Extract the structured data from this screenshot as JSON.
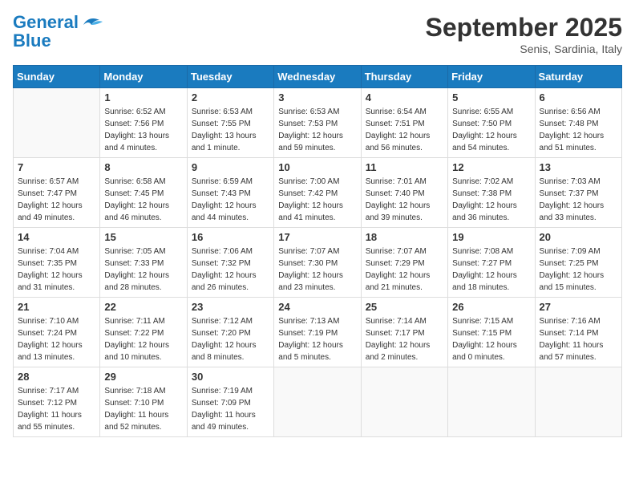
{
  "header": {
    "logo_line1": "General",
    "logo_line2": "Blue",
    "month_title": "September 2025",
    "location": "Senis, Sardinia, Italy"
  },
  "weekdays": [
    "Sunday",
    "Monday",
    "Tuesday",
    "Wednesday",
    "Thursday",
    "Friday",
    "Saturday"
  ],
  "weeks": [
    [
      {
        "day": "",
        "sunrise": "",
        "sunset": "",
        "daylight": ""
      },
      {
        "day": "1",
        "sunrise": "Sunrise: 6:52 AM",
        "sunset": "Sunset: 7:56 PM",
        "daylight": "Daylight: 13 hours and 4 minutes."
      },
      {
        "day": "2",
        "sunrise": "Sunrise: 6:53 AM",
        "sunset": "Sunset: 7:55 PM",
        "daylight": "Daylight: 13 hours and 1 minute."
      },
      {
        "day": "3",
        "sunrise": "Sunrise: 6:53 AM",
        "sunset": "Sunset: 7:53 PM",
        "daylight": "Daylight: 12 hours and 59 minutes."
      },
      {
        "day": "4",
        "sunrise": "Sunrise: 6:54 AM",
        "sunset": "Sunset: 7:51 PM",
        "daylight": "Daylight: 12 hours and 56 minutes."
      },
      {
        "day": "5",
        "sunrise": "Sunrise: 6:55 AM",
        "sunset": "Sunset: 7:50 PM",
        "daylight": "Daylight: 12 hours and 54 minutes."
      },
      {
        "day": "6",
        "sunrise": "Sunrise: 6:56 AM",
        "sunset": "Sunset: 7:48 PM",
        "daylight": "Daylight: 12 hours and 51 minutes."
      }
    ],
    [
      {
        "day": "7",
        "sunrise": "Sunrise: 6:57 AM",
        "sunset": "Sunset: 7:47 PM",
        "daylight": "Daylight: 12 hours and 49 minutes."
      },
      {
        "day": "8",
        "sunrise": "Sunrise: 6:58 AM",
        "sunset": "Sunset: 7:45 PM",
        "daylight": "Daylight: 12 hours and 46 minutes."
      },
      {
        "day": "9",
        "sunrise": "Sunrise: 6:59 AM",
        "sunset": "Sunset: 7:43 PM",
        "daylight": "Daylight: 12 hours and 44 minutes."
      },
      {
        "day": "10",
        "sunrise": "Sunrise: 7:00 AM",
        "sunset": "Sunset: 7:42 PM",
        "daylight": "Daylight: 12 hours and 41 minutes."
      },
      {
        "day": "11",
        "sunrise": "Sunrise: 7:01 AM",
        "sunset": "Sunset: 7:40 PM",
        "daylight": "Daylight: 12 hours and 39 minutes."
      },
      {
        "day": "12",
        "sunrise": "Sunrise: 7:02 AM",
        "sunset": "Sunset: 7:38 PM",
        "daylight": "Daylight: 12 hours and 36 minutes."
      },
      {
        "day": "13",
        "sunrise": "Sunrise: 7:03 AM",
        "sunset": "Sunset: 7:37 PM",
        "daylight": "Daylight: 12 hours and 33 minutes."
      }
    ],
    [
      {
        "day": "14",
        "sunrise": "Sunrise: 7:04 AM",
        "sunset": "Sunset: 7:35 PM",
        "daylight": "Daylight: 12 hours and 31 minutes."
      },
      {
        "day": "15",
        "sunrise": "Sunrise: 7:05 AM",
        "sunset": "Sunset: 7:33 PM",
        "daylight": "Daylight: 12 hours and 28 minutes."
      },
      {
        "day": "16",
        "sunrise": "Sunrise: 7:06 AM",
        "sunset": "Sunset: 7:32 PM",
        "daylight": "Daylight: 12 hours and 26 minutes."
      },
      {
        "day": "17",
        "sunrise": "Sunrise: 7:07 AM",
        "sunset": "Sunset: 7:30 PM",
        "daylight": "Daylight: 12 hours and 23 minutes."
      },
      {
        "day": "18",
        "sunrise": "Sunrise: 7:07 AM",
        "sunset": "Sunset: 7:29 PM",
        "daylight": "Daylight: 12 hours and 21 minutes."
      },
      {
        "day": "19",
        "sunrise": "Sunrise: 7:08 AM",
        "sunset": "Sunset: 7:27 PM",
        "daylight": "Daylight: 12 hours and 18 minutes."
      },
      {
        "day": "20",
        "sunrise": "Sunrise: 7:09 AM",
        "sunset": "Sunset: 7:25 PM",
        "daylight": "Daylight: 12 hours and 15 minutes."
      }
    ],
    [
      {
        "day": "21",
        "sunrise": "Sunrise: 7:10 AM",
        "sunset": "Sunset: 7:24 PM",
        "daylight": "Daylight: 12 hours and 13 minutes."
      },
      {
        "day": "22",
        "sunrise": "Sunrise: 7:11 AM",
        "sunset": "Sunset: 7:22 PM",
        "daylight": "Daylight: 12 hours and 10 minutes."
      },
      {
        "day": "23",
        "sunrise": "Sunrise: 7:12 AM",
        "sunset": "Sunset: 7:20 PM",
        "daylight": "Daylight: 12 hours and 8 minutes."
      },
      {
        "day": "24",
        "sunrise": "Sunrise: 7:13 AM",
        "sunset": "Sunset: 7:19 PM",
        "daylight": "Daylight: 12 hours and 5 minutes."
      },
      {
        "day": "25",
        "sunrise": "Sunrise: 7:14 AM",
        "sunset": "Sunset: 7:17 PM",
        "daylight": "Daylight: 12 hours and 2 minutes."
      },
      {
        "day": "26",
        "sunrise": "Sunrise: 7:15 AM",
        "sunset": "Sunset: 7:15 PM",
        "daylight": "Daylight: 12 hours and 0 minutes."
      },
      {
        "day": "27",
        "sunrise": "Sunrise: 7:16 AM",
        "sunset": "Sunset: 7:14 PM",
        "daylight": "Daylight: 11 hours and 57 minutes."
      }
    ],
    [
      {
        "day": "28",
        "sunrise": "Sunrise: 7:17 AM",
        "sunset": "Sunset: 7:12 PM",
        "daylight": "Daylight: 11 hours and 55 minutes."
      },
      {
        "day": "29",
        "sunrise": "Sunrise: 7:18 AM",
        "sunset": "Sunset: 7:10 PM",
        "daylight": "Daylight: 11 hours and 52 minutes."
      },
      {
        "day": "30",
        "sunrise": "Sunrise: 7:19 AM",
        "sunset": "Sunset: 7:09 PM",
        "daylight": "Daylight: 11 hours and 49 minutes."
      },
      {
        "day": "",
        "sunrise": "",
        "sunset": "",
        "daylight": ""
      },
      {
        "day": "",
        "sunrise": "",
        "sunset": "",
        "daylight": ""
      },
      {
        "day": "",
        "sunrise": "",
        "sunset": "",
        "daylight": ""
      },
      {
        "day": "",
        "sunrise": "",
        "sunset": "",
        "daylight": ""
      }
    ]
  ]
}
